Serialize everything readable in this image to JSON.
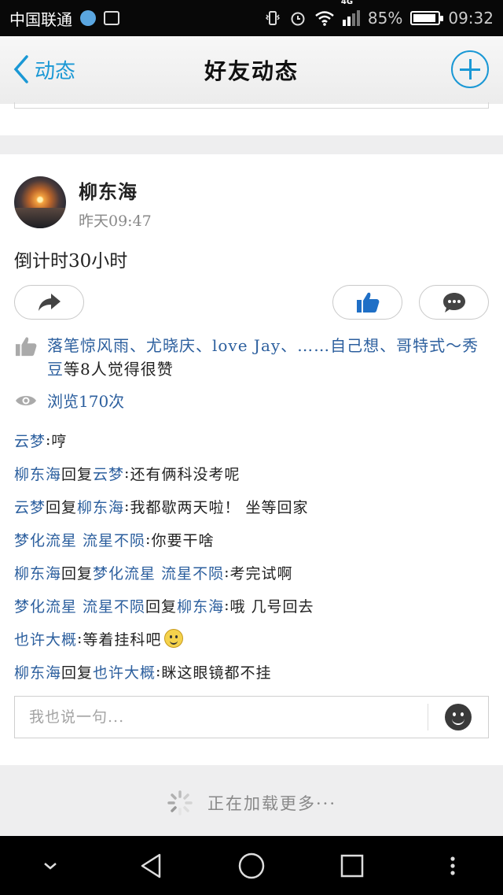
{
  "status_bar": {
    "carrier": "中国联通",
    "network": "4G",
    "battery": "85%",
    "time": "09:32"
  },
  "header": {
    "back_label": "动态",
    "title": "好友动态"
  },
  "post": {
    "author": "柳东海",
    "time": "昨天09:47",
    "text": "倒计时30小时",
    "likes": {
      "names": "落笔惊风雨、尤晓庆、love Jay、……自己想、哥特式～秀豆",
      "suffix": "等8人觉得很赞"
    },
    "views": "浏览170次",
    "comments": [
      {
        "from": "云梦",
        "reply_word": "",
        "to": "",
        "sep": ": ",
        "text": "哼"
      },
      {
        "from": "柳东海",
        "reply_word": "回复",
        "to": "云梦",
        "sep": ": ",
        "text": "还有俩科没考呢"
      },
      {
        "from": "云梦",
        "reply_word": "回复",
        "to": "柳东海",
        "sep": ": ",
        "text": "我都歇两天啦！ 坐等回家"
      },
      {
        "from": "梦化流星 流星不陨",
        "reply_word": "",
        "to": "",
        "sep": ": ",
        "text": "你要干啥"
      },
      {
        "from": "柳东海",
        "reply_word": "回复",
        "to": "梦化流星 流星不陨",
        "sep": ": ",
        "text": "考完试啊"
      },
      {
        "from": "梦化流星 流星不陨",
        "reply_word": "回复",
        "to": "柳东海",
        "sep": ": ",
        "text": "哦 几号回去"
      },
      {
        "from": "也许大概",
        "reply_word": "",
        "to": "",
        "sep": ": ",
        "text": "等着挂科吧"
      },
      {
        "from": "柳东海",
        "reply_word": "回复",
        "to": "也许大概",
        "sep": ": ",
        "text": "眯这眼镜都不挂"
      }
    ],
    "reply_placeholder": "我也说一句..."
  },
  "loading_text": "正在加载更多···",
  "colors": {
    "accent": "#1a98d5",
    "name_link": "#2c5f9e"
  }
}
